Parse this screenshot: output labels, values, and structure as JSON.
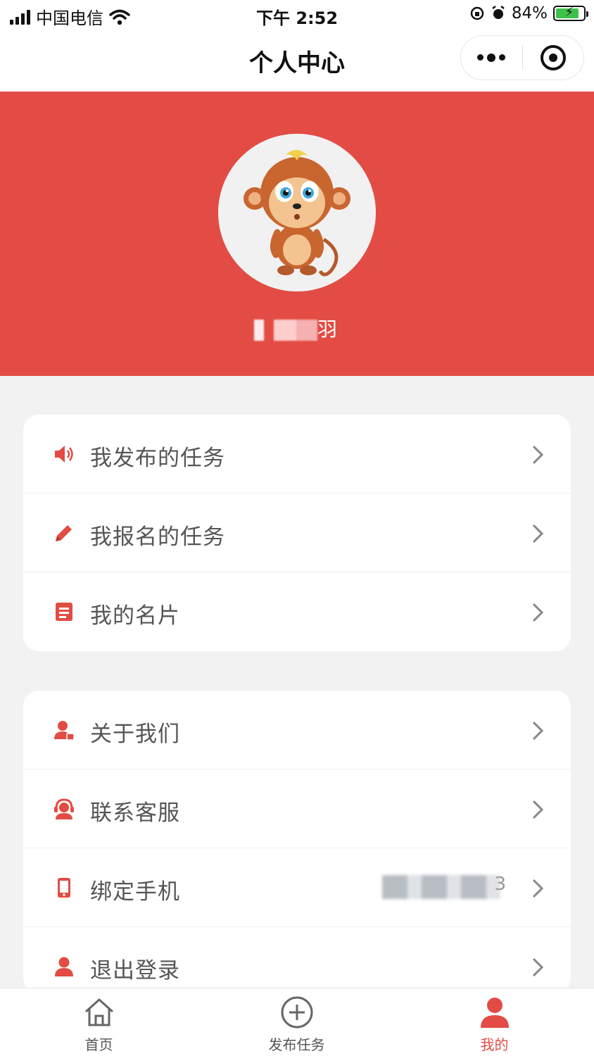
{
  "status_bar": {
    "carrier": "中国电信",
    "time": "下午 2:52",
    "battery_percent": "84%",
    "battery_level": 0.84
  },
  "nav": {
    "title": "个人中心",
    "more_icon": "more-dots-icon",
    "close_icon": "target-circle-icon"
  },
  "profile": {
    "avatar_icon": "monkey-cartoon-avatar",
    "username": "羽"
  },
  "menu_group_1": [
    {
      "label": "我发布的任务",
      "icon": "speaker-icon"
    },
    {
      "label": "我报名的任务",
      "icon": "pencil-icon"
    },
    {
      "label": "我的名片",
      "icon": "card-icon"
    }
  ],
  "menu_group_2": [
    {
      "label": "关于我们",
      "icon": "user-badge-icon"
    },
    {
      "label": "联系客服",
      "icon": "headset-icon"
    },
    {
      "label": "绑定手机",
      "icon": "phone-icon",
      "value": "3"
    },
    {
      "label": "退出登录",
      "icon": "user-icon"
    }
  ],
  "tabs": [
    {
      "label": "首页",
      "icon": "home-icon"
    },
    {
      "label": "发布任务",
      "icon": "plus-circle-icon"
    },
    {
      "label": "我的",
      "icon": "user-icon",
      "active": true
    }
  ],
  "colors": {
    "accent": "#e24c44",
    "background": "#f2f2f2",
    "text_secondary": "#555555"
  }
}
